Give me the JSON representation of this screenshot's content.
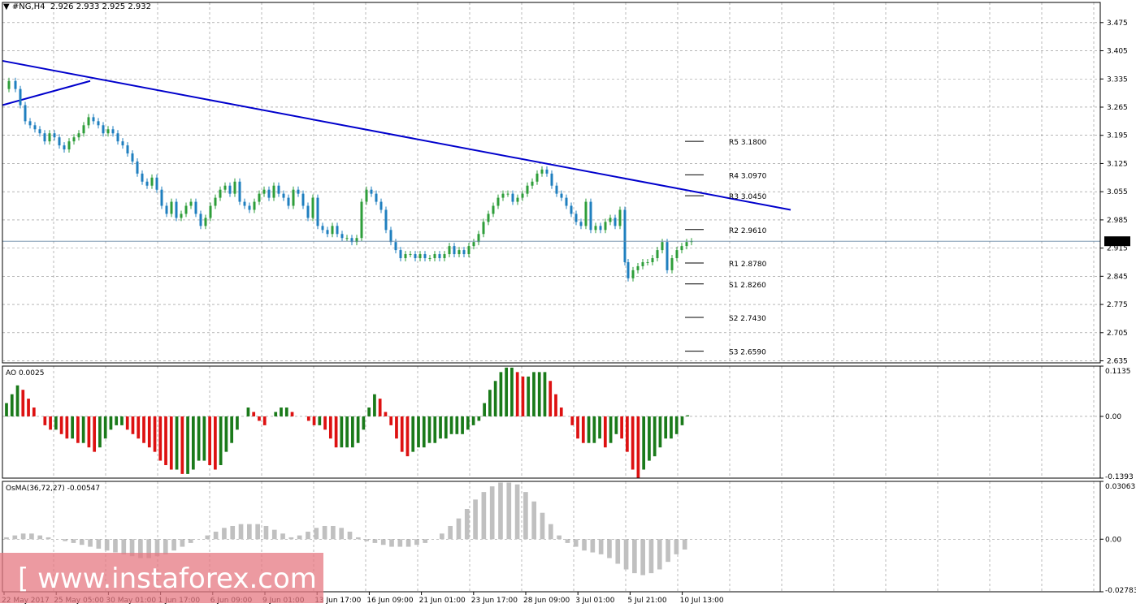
{
  "header": {
    "symbol": "#NG,H4",
    "ohlc": "2.926 2.933 2.925 2.932"
  },
  "price_badge": "2.932",
  "indicators": {
    "ao_label": "AO 0.0025",
    "osma_label": "OsMA(36,72,27) -0.00547"
  },
  "watermark": "[ www.instaforex.com ]",
  "colors": {
    "background": "#ffffff",
    "grid": "#8a8a8a",
    "trendline": "#0000cc",
    "candle_up": "#2e9e3a",
    "candle_down": "#1f7fbf",
    "ao_up": "#1a7a1a",
    "ao_down": "#dd1111",
    "osma": "#c0c0c0",
    "watermark_bg": "#e67882"
  },
  "chart_data": [
    {
      "type": "candlestick",
      "title": "#NG,H4",
      "price_axis_ticks": [
        "3.475",
        "3.405",
        "3.335",
        "3.265",
        "3.195",
        "3.125",
        "3.055",
        "2.985",
        "2.915",
        "2.845",
        "2.775",
        "2.705",
        "2.635"
      ],
      "ylim": [
        2.63,
        3.525
      ],
      "x_tick_labels": [
        "22 May 2017",
        "25 May 05:00",
        "30 May 01:00",
        "1 Jun 17:00",
        "6 Jun 09:00",
        "9 Jun 01:00",
        "13 Jun 17:00",
        "16 Jun 09:00",
        "21 Jun 01:00",
        "23 Jun 17:00",
        "28 Jun 09:00",
        "3 Jul 01:00",
        "5 Jul 21:00",
        "10 Jul 13:00"
      ],
      "close_path": [
        [
          0,
          3.31
        ],
        [
          8,
          3.33
        ],
        [
          16,
          3.31
        ],
        [
          22,
          3.27
        ],
        [
          28,
          3.23
        ],
        [
          34,
          3.22
        ],
        [
          40,
          3.21
        ],
        [
          46,
          3.2
        ],
        [
          52,
          3.18
        ],
        [
          58,
          3.2
        ],
        [
          64,
          3.19
        ],
        [
          70,
          3.17
        ],
        [
          76,
          3.16
        ],
        [
          82,
          3.18
        ],
        [
          88,
          3.19
        ],
        [
          94,
          3.2
        ],
        [
          100,
          3.22
        ],
        [
          106,
          3.24
        ],
        [
          112,
          3.23
        ],
        [
          118,
          3.22
        ],
        [
          124,
          3.2
        ],
        [
          130,
          3.21
        ],
        [
          136,
          3.2
        ],
        [
          142,
          3.18
        ],
        [
          148,
          3.17
        ],
        [
          154,
          3.15
        ],
        [
          160,
          3.13
        ],
        [
          166,
          3.1
        ],
        [
          172,
          3.08
        ],
        [
          178,
          3.07
        ],
        [
          184,
          3.09
        ],
        [
          190,
          3.06
        ],
        [
          196,
          3.02
        ],
        [
          202,
          3.0
        ],
        [
          208,
          3.03
        ],
        [
          214,
          2.99
        ],
        [
          220,
          3.0
        ],
        [
          226,
          3.02
        ],
        [
          232,
          3.03
        ],
        [
          238,
          3.0
        ],
        [
          244,
          2.97
        ],
        [
          250,
          2.99
        ],
        [
          256,
          3.02
        ],
        [
          262,
          3.04
        ],
        [
          268,
          3.06
        ],
        [
          274,
          3.07
        ],
        [
          280,
          3.05
        ],
        [
          286,
          3.08
        ],
        [
          292,
          3.03
        ],
        [
          298,
          3.02
        ],
        [
          304,
          3.01
        ],
        [
          310,
          3.03
        ],
        [
          316,
          3.05
        ],
        [
          322,
          3.06
        ],
        [
          328,
          3.04
        ],
        [
          334,
          3.07
        ],
        [
          340,
          3.05
        ],
        [
          346,
          3.04
        ],
        [
          352,
          3.02
        ],
        [
          358,
          3.06
        ],
        [
          364,
          3.05
        ],
        [
          370,
          3.02
        ],
        [
          376,
          2.99
        ],
        [
          382,
          3.04
        ],
        [
          388,
          2.97
        ],
        [
          394,
          2.96
        ],
        [
          400,
          2.95
        ],
        [
          406,
          2.97
        ],
        [
          412,
          2.95
        ],
        [
          418,
          2.94
        ],
        [
          424,
          2.94
        ],
        [
          430,
          2.93
        ],
        [
          436,
          2.94
        ],
        [
          442,
          3.03
        ],
        [
          448,
          3.06
        ],
        [
          454,
          3.05
        ],
        [
          460,
          3.03
        ],
        [
          466,
          3.01
        ],
        [
          472,
          2.96
        ],
        [
          478,
          2.93
        ],
        [
          484,
          2.91
        ],
        [
          490,
          2.89
        ],
        [
          496,
          2.9
        ],
        [
          502,
          2.9
        ],
        [
          508,
          2.89
        ],
        [
          514,
          2.9
        ],
        [
          520,
          2.89
        ],
        [
          526,
          2.89
        ],
        [
          532,
          2.9
        ],
        [
          538,
          2.89
        ],
        [
          544,
          2.9
        ],
        [
          550,
          2.92
        ],
        [
          556,
          2.9
        ],
        [
          562,
          2.91
        ],
        [
          568,
          2.9
        ],
        [
          574,
          2.92
        ],
        [
          580,
          2.93
        ],
        [
          586,
          2.95
        ],
        [
          592,
          2.98
        ],
        [
          598,
          3.0
        ],
        [
          604,
          3.02
        ],
        [
          610,
          3.04
        ],
        [
          616,
          3.05
        ],
        [
          622,
          3.05
        ],
        [
          628,
          3.03
        ],
        [
          634,
          3.04
        ],
        [
          640,
          3.05
        ],
        [
          646,
          3.07
        ],
        [
          652,
          3.08
        ],
        [
          658,
          3.1
        ],
        [
          664,
          3.11
        ],
        [
          670,
          3.1
        ],
        [
          676,
          3.07
        ],
        [
          682,
          3.05
        ],
        [
          688,
          3.04
        ],
        [
          694,
          3.02
        ],
        [
          700,
          3.0
        ],
        [
          706,
          2.98
        ],
        [
          712,
          2.97
        ],
        [
          718,
          3.03
        ],
        [
          724,
          2.96
        ],
        [
          730,
          2.97
        ],
        [
          736,
          2.96
        ],
        [
          742,
          2.98
        ],
        [
          748,
          2.99
        ],
        [
          754,
          2.97
        ],
        [
          760,
          3.01
        ],
        [
          766,
          2.88
        ],
        [
          770,
          2.84
        ],
        [
          776,
          2.86
        ],
        [
          782,
          2.87
        ],
        [
          788,
          2.88
        ],
        [
          794,
          2.88
        ],
        [
          800,
          2.89
        ],
        [
          806,
          2.91
        ],
        [
          812,
          2.93
        ],
        [
          818,
          2.86
        ],
        [
          824,
          2.89
        ],
        [
          830,
          2.91
        ],
        [
          836,
          2.92
        ],
        [
          842,
          2.93
        ],
        [
          848,
          2.932
        ]
      ],
      "trendlines": [
        {
          "from": [
            0,
            3.38
          ],
          "to": [
            970,
            3.01
          ]
        },
        {
          "from": [
            0,
            3.27
          ],
          "to": [
            108,
            3.33
          ]
        }
      ],
      "current_price": 2.932,
      "pivot_levels": [
        {
          "label": "R5 3.1800",
          "value": 3.18
        },
        {
          "label": "R4 3.0970",
          "value": 3.097
        },
        {
          "label": "R3 3.0450",
          "value": 3.045
        },
        {
          "label": "R2 2.9610",
          "value": 2.961
        },
        {
          "label": "R1 2.8780",
          "value": 2.878
        },
        {
          "label": "S1 2.8260",
          "value": 2.826
        },
        {
          "label": "S2 2.7430",
          "value": 2.743
        },
        {
          "label": "S3 2.6590",
          "value": 2.659
        }
      ]
    },
    {
      "type": "bar",
      "title": "AO 0.0025",
      "axis_ticks": [
        "0.1135",
        "0.00",
        "-0.1393"
      ],
      "ylim": [
        -0.1393,
        0.1135
      ],
      "values": [
        0.03,
        0.05,
        0.07,
        0.06,
        0.04,
        0.02,
        0.0,
        -0.02,
        -0.03,
        -0.03,
        -0.04,
        -0.05,
        -0.05,
        -0.06,
        -0.06,
        -0.07,
        -0.08,
        -0.07,
        -0.05,
        -0.03,
        -0.02,
        -0.02,
        -0.03,
        -0.04,
        -0.05,
        -0.06,
        -0.07,
        -0.08,
        -0.1,
        -0.11,
        -0.12,
        -0.12,
        -0.13,
        -0.13,
        -0.12,
        -0.1,
        -0.1,
        -0.11,
        -0.12,
        -0.11,
        -0.08,
        -0.06,
        -0.03,
        0.0,
        0.02,
        0.01,
        -0.01,
        -0.02,
        0.0,
        0.01,
        0.02,
        0.02,
        0.01,
        0.0,
        0.0,
        -0.01,
        -0.02,
        -0.02,
        -0.03,
        -0.05,
        -0.07,
        -0.07,
        -0.07,
        -0.07,
        -0.06,
        -0.03,
        0.02,
        0.05,
        0.04,
        0.01,
        -0.02,
        -0.05,
        -0.08,
        -0.09,
        -0.08,
        -0.07,
        -0.07,
        -0.06,
        -0.06,
        -0.05,
        -0.05,
        -0.04,
        -0.04,
        -0.04,
        -0.03,
        -0.02,
        -0.01,
        0.03,
        0.06,
        0.08,
        0.1,
        0.11,
        0.11,
        0.1,
        0.09,
        0.09,
        0.1,
        0.1,
        0.1,
        0.08,
        0.05,
        0.02,
        0.0,
        -0.02,
        -0.05,
        -0.06,
        -0.06,
        -0.06,
        -0.05,
        -0.07,
        -0.06,
        -0.04,
        -0.05,
        -0.08,
        -0.12,
        -0.14,
        -0.12,
        -0.1,
        -0.09,
        -0.07,
        -0.05,
        -0.05,
        -0.04,
        -0.02,
        0.0025
      ]
    },
    {
      "type": "bar",
      "title": "OsMA(36,72,27) -0.00547",
      "axis_ticks": [
        "0.03063",
        "0.00",
        "-0.02783"
      ],
      "ylim": [
        -0.02783,
        0.03063
      ],
      "values": [
        0.001,
        0.002,
        0.003,
        0.003,
        0.002,
        0.001,
        0.0,
        -0.001,
        -0.002,
        -0.003,
        -0.004,
        -0.005,
        -0.006,
        -0.007,
        -0.008,
        -0.009,
        -0.01,
        -0.01,
        -0.009,
        -0.008,
        -0.006,
        -0.004,
        -0.002,
        0.0,
        0.002,
        0.004,
        0.006,
        0.007,
        0.008,
        0.008,
        0.008,
        0.007,
        0.005,
        0.003,
        0.001,
        0.002,
        0.004,
        0.006,
        0.007,
        0.007,
        0.006,
        0.004,
        0.001,
        -0.001,
        -0.002,
        -0.003,
        -0.004,
        -0.004,
        -0.004,
        -0.003,
        -0.002,
        0.0,
        0.003,
        0.007,
        0.011,
        0.016,
        0.021,
        0.025,
        0.028,
        0.03,
        0.03,
        0.029,
        0.025,
        0.02,
        0.014,
        0.008,
        0.002,
        -0.002,
        -0.004,
        -0.006,
        -0.007,
        -0.008,
        -0.01,
        -0.013,
        -0.016,
        -0.018,
        -0.019,
        -0.018,
        -0.016,
        -0.012,
        -0.008,
        -0.00547
      ]
    }
  ]
}
